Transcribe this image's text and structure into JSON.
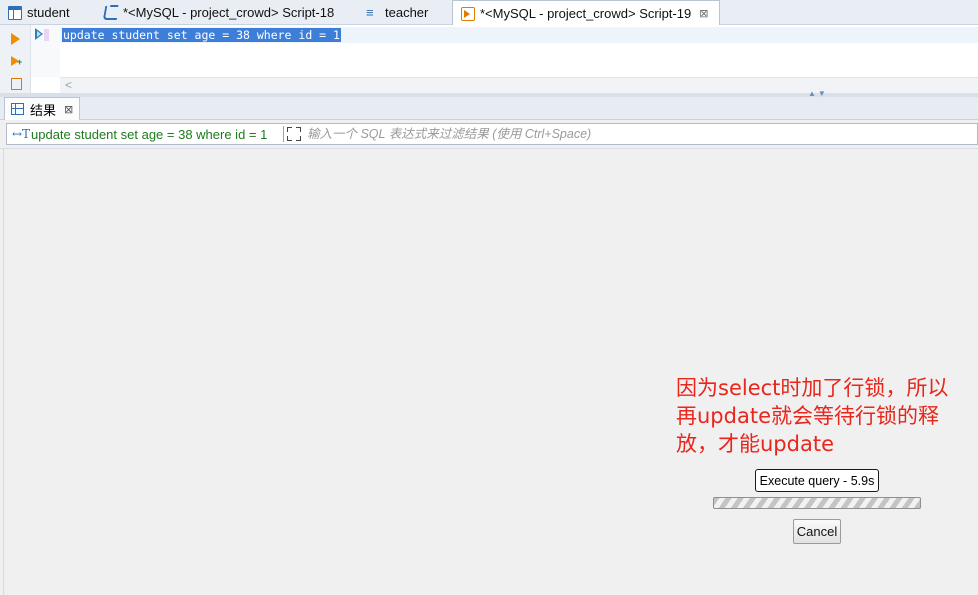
{
  "tabs": [
    {
      "label": "student",
      "icon": "table-icon",
      "active": false
    },
    {
      "label": "*<MySQL - project_crowd> Script-18",
      "icon": "sql-script-icon",
      "active": false
    },
    {
      "label": "teacher",
      "icon": "table-editor-icon",
      "active": false
    },
    {
      "label": "*<MySQL - project_crowd> Script-19",
      "icon": "sql-script-active-icon",
      "active": true
    }
  ],
  "tab_close_glyph": "⊠",
  "editor": {
    "sql": "update student set age = 38 where id = 1",
    "scroll_left_glyph": "<"
  },
  "splitter_arrows": "▲▼",
  "results": {
    "tab_label": "结果",
    "close_glyph": "⊠",
    "filter_icon_glyph": "↔T",
    "filter_query": "update student set age = 38 where id = 1",
    "filter_placeholder": "输入一个 SQL 表达式来过滤结果 (使用 Ctrl+Space)"
  },
  "annotation": {
    "lines": [
      "因为select时加了行锁，所以",
      "再update就会等待行锁的释",
      "放，才能update"
    ],
    "color": "#e8261c"
  },
  "execution": {
    "status_label": "Execute query - 5.9s",
    "cancel_label": "Cancel",
    "progress_indeterminate": true
  },
  "colors": {
    "selection": "#3d7fd8",
    "accent": "#2f6fb5",
    "run_orange": "#f08c00",
    "filter_sql_green": "#1e7b1e"
  }
}
